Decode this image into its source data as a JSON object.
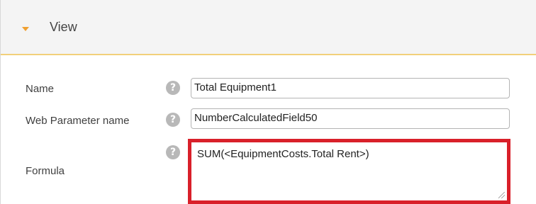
{
  "section": {
    "title": "View",
    "icon": "caret-down-icon"
  },
  "fields": {
    "name": {
      "label": "Name",
      "value": "Total Equipment1",
      "help": "?"
    },
    "web_parameter": {
      "label": "Web Parameter name",
      "value": "NumberCalculatedField50",
      "help": "?"
    },
    "formula": {
      "label": "Formula",
      "value": "SUM(<EquipmentCosts.Total Rent>)",
      "help": "?"
    }
  },
  "colors": {
    "highlight": "#d9202a",
    "caret": "#f0a030",
    "header_border": "#f2d07a"
  }
}
